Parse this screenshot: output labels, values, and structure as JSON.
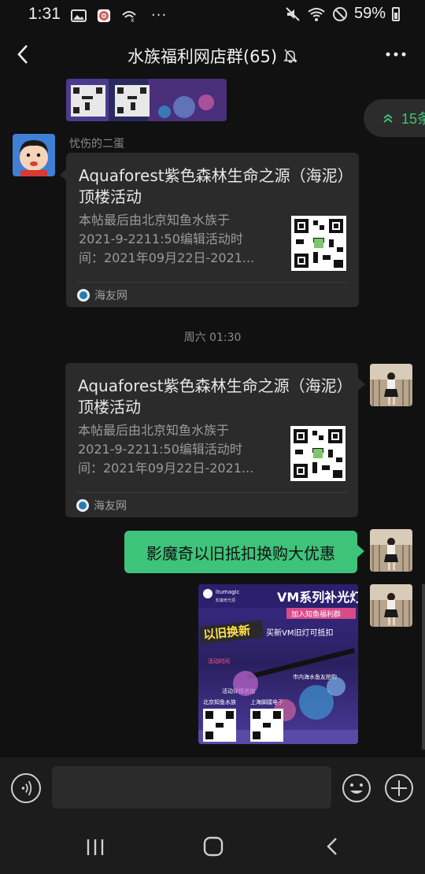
{
  "status_bar": {
    "time": "1:31",
    "battery": "59%"
  },
  "header": {
    "title": "水族福利网店群(65)"
  },
  "unread": {
    "count_label": "15条"
  },
  "messages": {
    "sender_name": "忧伤的二蛋",
    "card1": {
      "title": "Aquaforest紫色森林生命之源（海泥）顶楼活动",
      "desc_line1": "本帖最后由北京知鱼水族于",
      "desc_line2": "2021-9-2211:50编辑活动时",
      "desc_line3": "间：2021年09月22日-2021...",
      "source": "海友网"
    },
    "timestamp": "周六 01:30",
    "card2": {
      "title": "Aquaforest紫色森林生命之源（海泥）顶楼活动",
      "desc_line1": "本帖最后由北京知鱼水族于",
      "desc_line2": "2021-9-2211:50编辑活动时",
      "desc_line3": "间：2021年09月22日-2021...",
      "source": "海友网"
    },
    "text_message": "影魔奇以旧抵扣换购大优惠",
    "promo": {
      "brand": "itumagic",
      "brand_sub": "影魔奇光源",
      "headline": "VM系列补光灯",
      "subline": "加入知鱼福利群",
      "badge": "以旧换新",
      "tagline": "买新VM旧灯可抵扣",
      "line_a": "活动时间",
      "line_b": "市内海水鱼友抢购",
      "line_c": "活动详情咨询",
      "line_d": "北京知鱼水族",
      "line_e": "上海脚蹼电子"
    }
  },
  "colors": {
    "accent_green": "#3ec37a",
    "bubble_gray": "#2b2b2b",
    "background": "#111111"
  }
}
